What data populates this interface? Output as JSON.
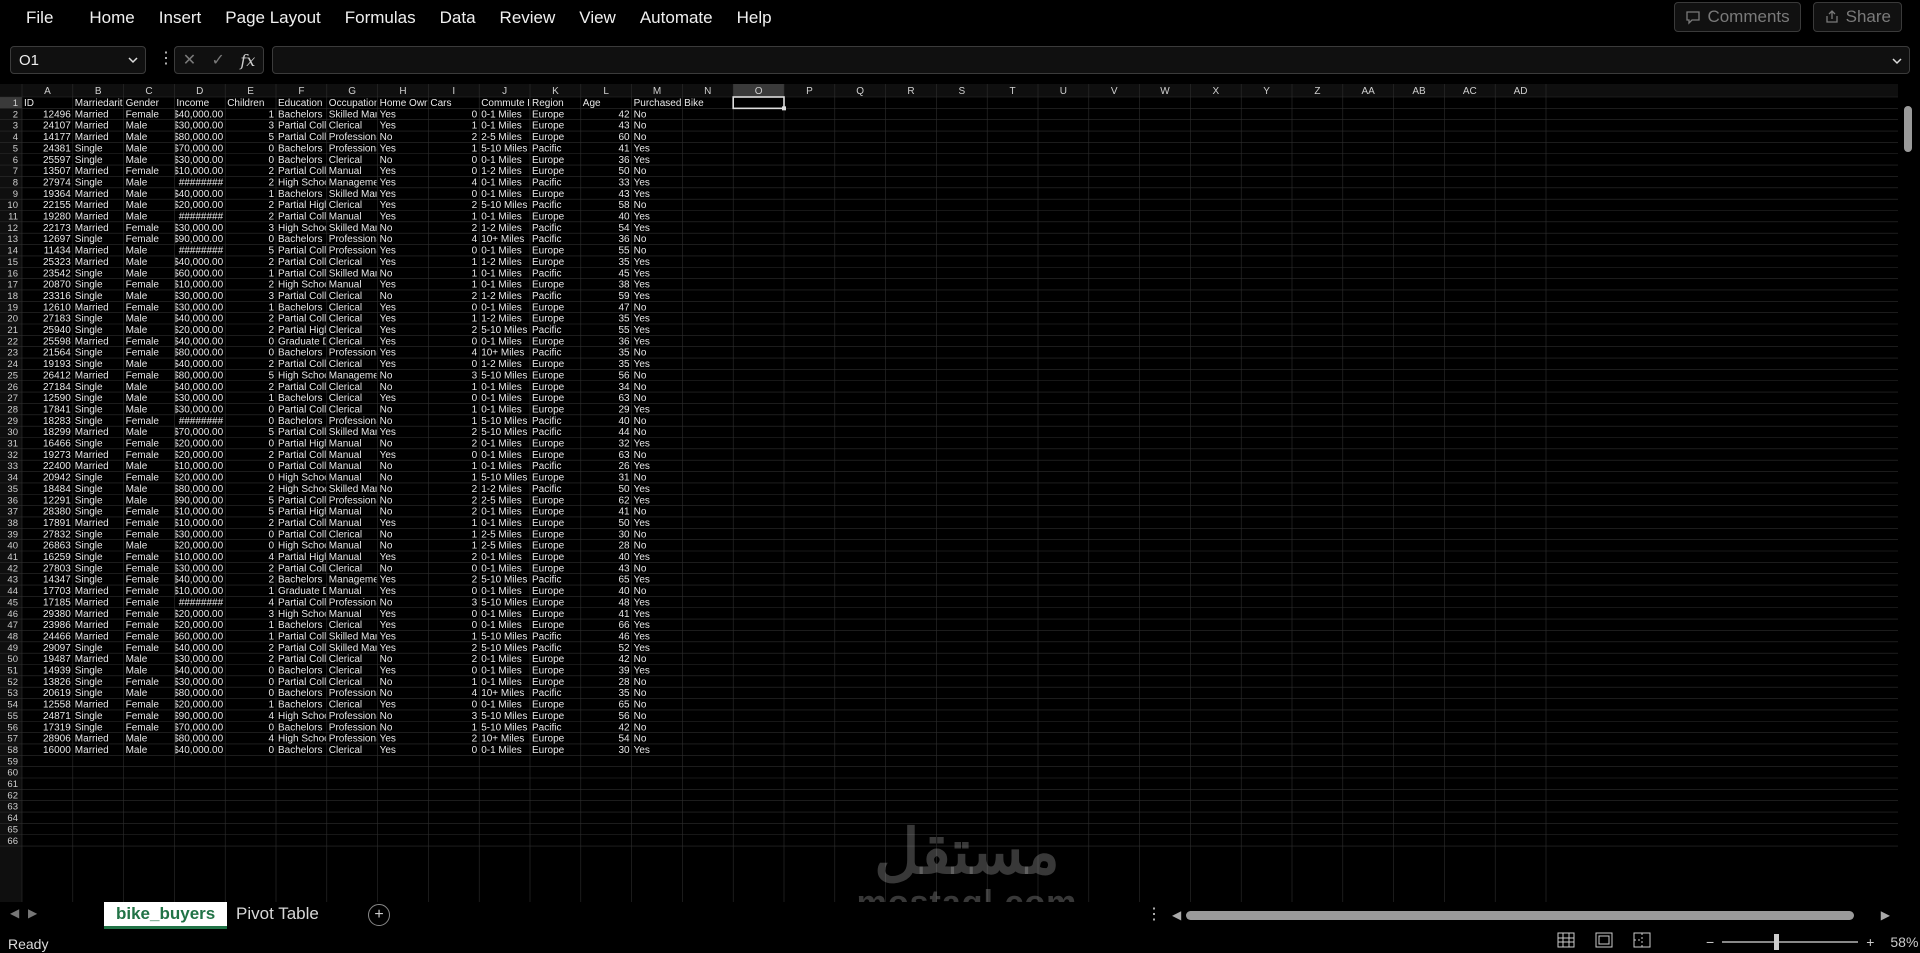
{
  "menu": [
    "File",
    "Home",
    "Insert",
    "Page Layout",
    "Formulas",
    "Data",
    "Review",
    "View",
    "Automate",
    "Help"
  ],
  "toolbar": {
    "comments": "Comments",
    "share": "Share",
    "comments_icon": "comment-icon",
    "share_icon": "share-icon"
  },
  "namebox": {
    "value": "O1"
  },
  "formula": {
    "value": ""
  },
  "columns": [
    "A",
    "B",
    "C",
    "D",
    "E",
    "F",
    "G",
    "H",
    "I",
    "J",
    "K",
    "L",
    "M",
    "N",
    "O",
    "P",
    "Q",
    "R",
    "S",
    "T",
    "U",
    "V",
    "W",
    "X",
    "Y",
    "Z",
    "AA",
    "AB",
    "AC",
    "AD"
  ],
  "selected_cell": "O1",
  "headers": [
    "ID",
    "Marriedarital",
    "Gender",
    "Income",
    "Children",
    "Education",
    "Occupation",
    "Home Owner",
    "Cars",
    "Commute Distance",
    "Region",
    "Age",
    "Purchased Bike"
  ],
  "rows": [
    [
      "12496",
      "Married",
      "Female",
      "$40,000.00",
      "1",
      "Bachelors",
      "Skilled Manual",
      "Yes",
      "0",
      "0-1 Miles",
      "Europe",
      "42",
      "No"
    ],
    [
      "24107",
      "Married",
      "Male",
      "$30,000.00",
      "3",
      "Partial College",
      "Clerical",
      "Yes",
      "1",
      "0-1 Miles",
      "Europe",
      "43",
      "No"
    ],
    [
      "14177",
      "Married",
      "Male",
      "$80,000.00",
      "5",
      "Partial College",
      "Professional",
      "No",
      "2",
      "2-5 Miles",
      "Europe",
      "60",
      "No"
    ],
    [
      "24381",
      "Single",
      "Male",
      "$70,000.00",
      "0",
      "Bachelors",
      "Professional",
      "Yes",
      "1",
      "5-10 Miles",
      "Pacific",
      "41",
      "Yes"
    ],
    [
      "25597",
      "Single",
      "Male",
      "$30,000.00",
      "0",
      "Bachelors",
      "Clerical",
      "No",
      "0",
      "0-1 Miles",
      "Europe",
      "36",
      "Yes"
    ],
    [
      "13507",
      "Married",
      "Female",
      "$10,000.00",
      "2",
      "Partial College",
      "Manual",
      "Yes",
      "0",
      "1-2 Miles",
      "Europe",
      "50",
      "No"
    ],
    [
      "27974",
      "Single",
      "Male",
      "########",
      "2",
      "High School",
      "Management",
      "Yes",
      "4",
      "0-1 Miles",
      "Pacific",
      "33",
      "Yes"
    ],
    [
      "19364",
      "Married",
      "Male",
      "$40,000.00",
      "1",
      "Bachelors",
      "Skilled Manual",
      "Yes",
      "0",
      "0-1 Miles",
      "Europe",
      "43",
      "Yes"
    ],
    [
      "22155",
      "Married",
      "Male",
      "$20,000.00",
      "2",
      "Partial High School",
      "Clerical",
      "Yes",
      "2",
      "5-10 Miles",
      "Pacific",
      "58",
      "No"
    ],
    [
      "19280",
      "Married",
      "Male",
      "########",
      "2",
      "Partial College",
      "Manual",
      "Yes",
      "1",
      "0-1 Miles",
      "Europe",
      "40",
      "Yes"
    ],
    [
      "22173",
      "Married",
      "Female",
      "$30,000.00",
      "3",
      "High School",
      "Skilled Manual",
      "No",
      "2",
      "1-2 Miles",
      "Pacific",
      "54",
      "Yes"
    ],
    [
      "12697",
      "Single",
      "Female",
      "$90,000.00",
      "0",
      "Bachelors",
      "Professional",
      "No",
      "4",
      "10+ Miles",
      "Pacific",
      "36",
      "No"
    ],
    [
      "11434",
      "Married",
      "Male",
      "########",
      "5",
      "Partial College",
      "Professional",
      "Yes",
      "0",
      "0-1 Miles",
      "Europe",
      "55",
      "No"
    ],
    [
      "25323",
      "Married",
      "Male",
      "$40,000.00",
      "2",
      "Partial College",
      "Clerical",
      "Yes",
      "1",
      "1-2 Miles",
      "Europe",
      "35",
      "Yes"
    ],
    [
      "23542",
      "Single",
      "Male",
      "$60,000.00",
      "1",
      "Partial College",
      "Skilled Manual",
      "No",
      "1",
      "0-1 Miles",
      "Pacific",
      "45",
      "Yes"
    ],
    [
      "20870",
      "Single",
      "Female",
      "$10,000.00",
      "2",
      "High School",
      "Manual",
      "Yes",
      "1",
      "0-1 Miles",
      "Europe",
      "38",
      "Yes"
    ],
    [
      "23316",
      "Single",
      "Male",
      "$30,000.00",
      "3",
      "Partial College",
      "Clerical",
      "No",
      "2",
      "1-2 Miles",
      "Pacific",
      "59",
      "Yes"
    ],
    [
      "12610",
      "Married",
      "Female",
      "$30,000.00",
      "1",
      "Bachelors",
      "Clerical",
      "Yes",
      "0",
      "0-1 Miles",
      "Europe",
      "47",
      "No"
    ],
    [
      "27183",
      "Single",
      "Male",
      "$40,000.00",
      "2",
      "Partial College",
      "Clerical",
      "Yes",
      "1",
      "1-2 Miles",
      "Europe",
      "35",
      "Yes"
    ],
    [
      "25940",
      "Single",
      "Male",
      "$20,000.00",
      "2",
      "Partial High School",
      "Clerical",
      "Yes",
      "2",
      "5-10 Miles",
      "Pacific",
      "55",
      "Yes"
    ],
    [
      "25598",
      "Married",
      "Female",
      "$40,000.00",
      "0",
      "Graduate Degree",
      "Clerical",
      "Yes",
      "0",
      "0-1 Miles",
      "Europe",
      "36",
      "Yes"
    ],
    [
      "21564",
      "Single",
      "Female",
      "$80,000.00",
      "0",
      "Bachelors",
      "Professional",
      "Yes",
      "4",
      "10+ Miles",
      "Pacific",
      "35",
      "No"
    ],
    [
      "19193",
      "Single",
      "Male",
      "$40,000.00",
      "2",
      "Partial College",
      "Clerical",
      "Yes",
      "0",
      "1-2 Miles",
      "Europe",
      "35",
      "Yes"
    ],
    [
      "26412",
      "Married",
      "Female",
      "$80,000.00",
      "5",
      "High School",
      "Management",
      "No",
      "3",
      "5-10 Miles",
      "Europe",
      "56",
      "No"
    ],
    [
      "27184",
      "Single",
      "Male",
      "$40,000.00",
      "2",
      "Partial College",
      "Clerical",
      "No",
      "1",
      "0-1 Miles",
      "Europe",
      "34",
      "No"
    ],
    [
      "12590",
      "Single",
      "Male",
      "$30,000.00",
      "1",
      "Bachelors",
      "Clerical",
      "Yes",
      "0",
      "0-1 Miles",
      "Europe",
      "63",
      "No"
    ],
    [
      "17841",
      "Single",
      "Male",
      "$30,000.00",
      "0",
      "Partial College",
      "Clerical",
      "No",
      "1",
      "0-1 Miles",
      "Europe",
      "29",
      "Yes"
    ],
    [
      "18283",
      "Single",
      "Female",
      "########",
      "0",
      "Bachelors",
      "Professional",
      "No",
      "1",
      "5-10 Miles",
      "Pacific",
      "40",
      "No"
    ],
    [
      "18299",
      "Married",
      "Male",
      "$70,000.00",
      "5",
      "Partial College",
      "Skilled Manual",
      "Yes",
      "2",
      "5-10 Miles",
      "Pacific",
      "44",
      "No"
    ],
    [
      "16466",
      "Single",
      "Female",
      "$20,000.00",
      "0",
      "Partial High School",
      "Manual",
      "No",
      "2",
      "0-1 Miles",
      "Europe",
      "32",
      "Yes"
    ],
    [
      "19273",
      "Married",
      "Female",
      "$20,000.00",
      "2",
      "Partial College",
      "Manual",
      "Yes",
      "0",
      "0-1 Miles",
      "Europe",
      "63",
      "No"
    ],
    [
      "22400",
      "Married",
      "Male",
      "$10,000.00",
      "0",
      "Partial College",
      "Manual",
      "No",
      "1",
      "0-1 Miles",
      "Pacific",
      "26",
      "Yes"
    ],
    [
      "20942",
      "Single",
      "Female",
      "$20,000.00",
      "0",
      "High School",
      "Manual",
      "No",
      "1",
      "5-10 Miles",
      "Europe",
      "31",
      "No"
    ],
    [
      "18484",
      "Single",
      "Male",
      "$80,000.00",
      "2",
      "High School",
      "Skilled Manual",
      "No",
      "2",
      "1-2 Miles",
      "Pacific",
      "50",
      "Yes"
    ],
    [
      "12291",
      "Single",
      "Male",
      "$90,000.00",
      "5",
      "Partial College",
      "Professional",
      "No",
      "2",
      "2-5 Miles",
      "Europe",
      "62",
      "Yes"
    ],
    [
      "28380",
      "Single",
      "Female",
      "$10,000.00",
      "5",
      "Partial High School",
      "Manual",
      "No",
      "2",
      "0-1 Miles",
      "Europe",
      "41",
      "No"
    ],
    [
      "17891",
      "Married",
      "Female",
      "$10,000.00",
      "2",
      "Partial College",
      "Manual",
      "Yes",
      "1",
      "0-1 Miles",
      "Europe",
      "50",
      "Yes"
    ],
    [
      "27832",
      "Single",
      "Female",
      "$30,000.00",
      "0",
      "Partial College",
      "Clerical",
      "No",
      "1",
      "2-5 Miles",
      "Europe",
      "30",
      "No"
    ],
    [
      "26863",
      "Single",
      "Male",
      "$20,000.00",
      "0",
      "High School",
      "Manual",
      "No",
      "1",
      "2-5 Miles",
      "Europe",
      "28",
      "No"
    ],
    [
      "16259",
      "Single",
      "Female",
      "$10,000.00",
      "4",
      "Partial High School",
      "Manual",
      "Yes",
      "2",
      "0-1 Miles",
      "Europe",
      "40",
      "Yes"
    ],
    [
      "27803",
      "Single",
      "Female",
      "$30,000.00",
      "2",
      "Partial College",
      "Clerical",
      "No",
      "0",
      "0-1 Miles",
      "Europe",
      "43",
      "No"
    ],
    [
      "14347",
      "Single",
      "Female",
      "$40,000.00",
      "2",
      "Bachelors",
      "Management",
      "Yes",
      "2",
      "5-10 Miles",
      "Pacific",
      "65",
      "Yes"
    ],
    [
      "17703",
      "Married",
      "Female",
      "$10,000.00",
      "1",
      "Graduate Degree",
      "Manual",
      "Yes",
      "0",
      "0-1 Miles",
      "Europe",
      "40",
      "No"
    ],
    [
      "17185",
      "Married",
      "Female",
      "########",
      "4",
      "Partial College",
      "Professional",
      "No",
      "3",
      "5-10 Miles",
      "Europe",
      "48",
      "Yes"
    ],
    [
      "29380",
      "Married",
      "Female",
      "$20,000.00",
      "3",
      "High School",
      "Manual",
      "Yes",
      "0",
      "0-1 Miles",
      "Europe",
      "41",
      "Yes"
    ],
    [
      "23986",
      "Married",
      "Female",
      "$20,000.00",
      "1",
      "Bachelors",
      "Clerical",
      "Yes",
      "0",
      "0-1 Miles",
      "Europe",
      "66",
      "Yes"
    ],
    [
      "24466",
      "Married",
      "Female",
      "$60,000.00",
      "1",
      "Partial College",
      "Skilled Manual",
      "Yes",
      "1",
      "5-10 Miles",
      "Pacific",
      "46",
      "Yes"
    ],
    [
      "29097",
      "Single",
      "Female",
      "$40,000.00",
      "2",
      "Partial College",
      "Skilled Manual",
      "Yes",
      "2",
      "5-10 Miles",
      "Pacific",
      "52",
      "Yes"
    ],
    [
      "19487",
      "Married",
      "Male",
      "$30,000.00",
      "2",
      "Partial College",
      "Clerical",
      "No",
      "2",
      "0-1 Miles",
      "Europe",
      "42",
      "No"
    ],
    [
      "14939",
      "Single",
      "Male",
      "$40,000.00",
      "0",
      "Bachelors",
      "Clerical",
      "Yes",
      "0",
      "0-1 Miles",
      "Europe",
      "39",
      "Yes"
    ],
    [
      "13826",
      "Single",
      "Female",
      "$30,000.00",
      "0",
      "Partial College",
      "Clerical",
      "No",
      "1",
      "0-1 Miles",
      "Europe",
      "28",
      "No"
    ],
    [
      "20619",
      "Single",
      "Male",
      "$80,000.00",
      "0",
      "Bachelors",
      "Professional",
      "No",
      "4",
      "10+ Miles",
      "Pacific",
      "35",
      "No"
    ],
    [
      "12558",
      "Married",
      "Female",
      "$20,000.00",
      "1",
      "Bachelors",
      "Clerical",
      "Yes",
      "0",
      "0-1 Miles",
      "Europe",
      "65",
      "No"
    ],
    [
      "24871",
      "Single",
      "Female",
      "$90,000.00",
      "4",
      "High School",
      "Professional",
      "No",
      "3",
      "5-10 Miles",
      "Europe",
      "56",
      "No"
    ],
    [
      "17319",
      "Single",
      "Female",
      "$70,000.00",
      "0",
      "Bachelors",
      "Professional",
      "No",
      "1",
      "5-10 Miles",
      "Pacific",
      "42",
      "No"
    ],
    [
      "28906",
      "Married",
      "Male",
      "$80,000.00",
      "4",
      "High School",
      "Professional",
      "Yes",
      "2",
      "10+ Miles",
      "Europe",
      "54",
      "No"
    ],
    [
      "16000",
      "Married",
      "Male",
      "$40,000.00",
      "0",
      "Bachelors",
      "Clerical",
      "Yes",
      "0",
      "0-1 Miles",
      "Europe",
      "30",
      "Yes"
    ]
  ],
  "sheets": [
    {
      "name": "bike_buyers",
      "active": true
    },
    {
      "name": "Pivot Table",
      "active": false
    }
  ],
  "status": {
    "text": "Ready",
    "zoom": "58%",
    "zoom_fraction": 0.38
  },
  "watermark": {
    "arabic": "مستقل",
    "latin": "mostaql.com"
  },
  "colors": {
    "accent": "#217346",
    "grid_line": "#2e2e2e",
    "header_bg": "#0f0f0f",
    "cell_text": "#e8e8e8",
    "header_text": "#cfcfcf",
    "selection": "#dddddd"
  }
}
